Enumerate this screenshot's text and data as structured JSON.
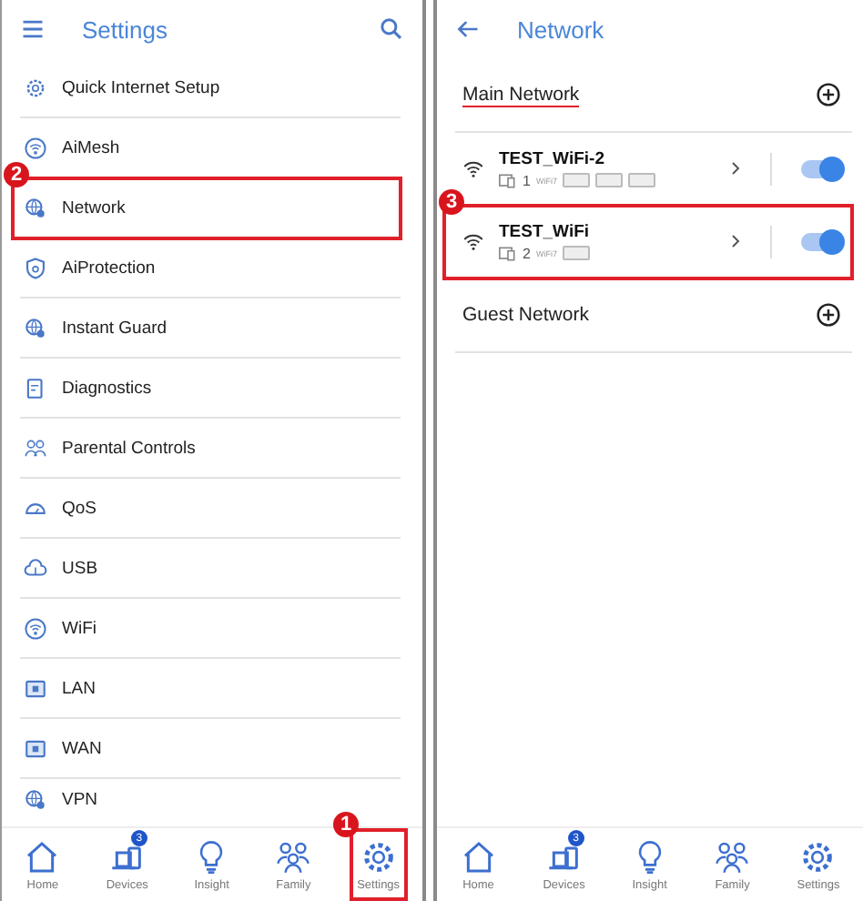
{
  "settings_screen": {
    "title": "Settings",
    "items": [
      {
        "label": "Quick Internet Setup"
      },
      {
        "label": "AiMesh"
      },
      {
        "label": "Network",
        "callout": "2"
      },
      {
        "label": "AiProtection"
      },
      {
        "label": "Instant Guard"
      },
      {
        "label": "Diagnostics"
      },
      {
        "label": "Parental Controls"
      },
      {
        "label": "QoS"
      },
      {
        "label": "USB"
      },
      {
        "label": "WiFi"
      },
      {
        "label": "LAN"
      },
      {
        "label": "WAN"
      },
      {
        "label": "VPN"
      }
    ],
    "nav": [
      {
        "label": "Home"
      },
      {
        "label": "Devices",
        "badge": "3"
      },
      {
        "label": "Insight"
      },
      {
        "label": "Family"
      },
      {
        "label": "Settings",
        "callout": "1"
      }
    ]
  },
  "network_screen": {
    "title": "Network",
    "sections": [
      {
        "label": "Main Network",
        "underlined": true,
        "networks": [
          {
            "name": "TEST_WiFi-2",
            "clients": "1",
            "standard": "WiFi7",
            "tags": [
              {
                "kind": "band"
              },
              {
                "kind": "band"
              },
              {
                "kind": "band"
              }
            ],
            "on": true
          },
          {
            "name": "TEST_WiFi",
            "clients": "2",
            "standard": "WiFi7",
            "tags": [
              {
                "kind": "band"
              }
            ],
            "on": true,
            "callout": "3"
          }
        ]
      },
      {
        "label": "Guest Network",
        "underlined": false
      }
    ],
    "nav": [
      {
        "label": "Home"
      },
      {
        "label": "Devices",
        "badge": "3"
      },
      {
        "label": "Insight"
      },
      {
        "label": "Family"
      },
      {
        "label": "Settings"
      }
    ]
  }
}
